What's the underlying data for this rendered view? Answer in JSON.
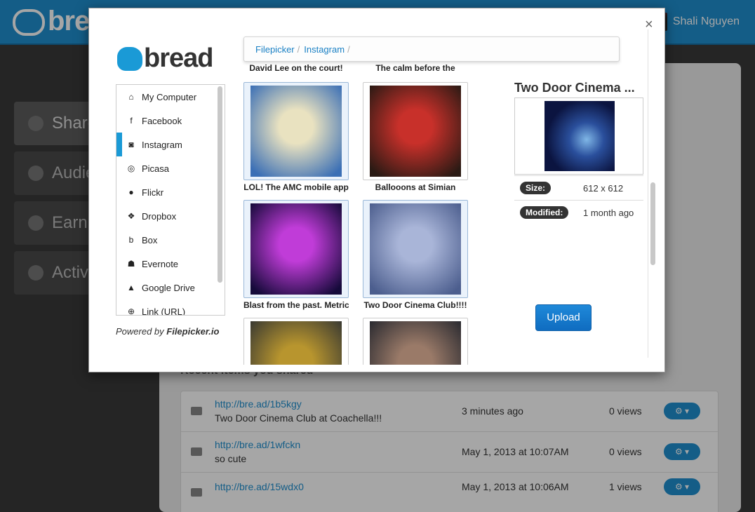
{
  "app": {
    "logo": "bread"
  },
  "user": {
    "name": "Shali Nguyen"
  },
  "sidenav": [
    {
      "label": "Share"
    },
    {
      "label": "Audience"
    },
    {
      "label": "Earnings"
    },
    {
      "label": "Activity"
    }
  ],
  "recent": {
    "title": "Recent items you shared",
    "rows": [
      {
        "link": "http://bre.ad/1b5kgy",
        "desc": "Two Door Cinema Club at Coachella!!!",
        "time": "3 minutes ago",
        "views": "0 views"
      },
      {
        "link": "http://bre.ad/1wfckn",
        "desc": "so cute",
        "time": "May 1, 2013 at 10:07AM",
        "views": "0 views"
      },
      {
        "link": "http://bre.ad/15wdx0",
        "desc": "",
        "time": "May 1, 2013 at 10:06AM",
        "views": "1 views"
      }
    ]
  },
  "modal": {
    "close": "×",
    "logo_text": "bread",
    "breadcrumb": {
      "root": "Filepicker",
      "current": "Instagram",
      "sep": "/"
    },
    "sources": [
      {
        "label": "My Computer",
        "icon": "home-icon",
        "glyph": "⌂"
      },
      {
        "label": "Facebook",
        "icon": "facebook-icon",
        "glyph": "f"
      },
      {
        "label": "Instagram",
        "icon": "instagram-icon",
        "glyph": "◙",
        "active": true
      },
      {
        "label": "Picasa",
        "icon": "picasa-icon",
        "glyph": "◎"
      },
      {
        "label": "Flickr",
        "icon": "flickr-icon",
        "glyph": "●"
      },
      {
        "label": "Dropbox",
        "icon": "dropbox-icon",
        "glyph": "❖"
      },
      {
        "label": "Box",
        "icon": "box-icon",
        "glyph": "b"
      },
      {
        "label": "Evernote",
        "icon": "evernote-icon",
        "glyph": "☗"
      },
      {
        "label": "Google Drive",
        "icon": "google-drive-icon",
        "glyph": "▲"
      },
      {
        "label": "Link (URL)",
        "icon": "link-icon",
        "glyph": "⊕"
      }
    ],
    "powered_prefix": "Powered by ",
    "powered_brand": "Filepicker.io",
    "grid": {
      "top_captions": [
        "David Lee on the court!",
        "The calm before the"
      ],
      "items": [
        {
          "caption": "LOL! The AMC mobile app",
          "colors": [
            "#e9e2c0",
            "#3b6fb5"
          ]
        },
        {
          "caption": "Ballooons at Simian",
          "colors": [
            "#c8302a",
            "#2a1a14"
          ]
        },
        {
          "caption": "Blast from the past. Metric",
          "colors": [
            "#c03cd8",
            "#150a3a"
          ]
        },
        {
          "caption": "Two Door Cinema Club!!!!",
          "colors": [
            "#a9b5d8",
            "#4c5e8e"
          ]
        },
        {
          "caption": "",
          "colors": [
            "#b8952e",
            "#3a3a32"
          ]
        },
        {
          "caption": "",
          "colors": [
            "#9a7a68",
            "#2a2a30"
          ]
        }
      ],
      "selected_index": 3
    },
    "preview": {
      "title": "Two Door Cinema ...",
      "size_label": "Size:",
      "size_value": "612 x 612",
      "modified_label": "Modified:",
      "modified_value": "1 month ago"
    },
    "upload_label": "Upload"
  }
}
